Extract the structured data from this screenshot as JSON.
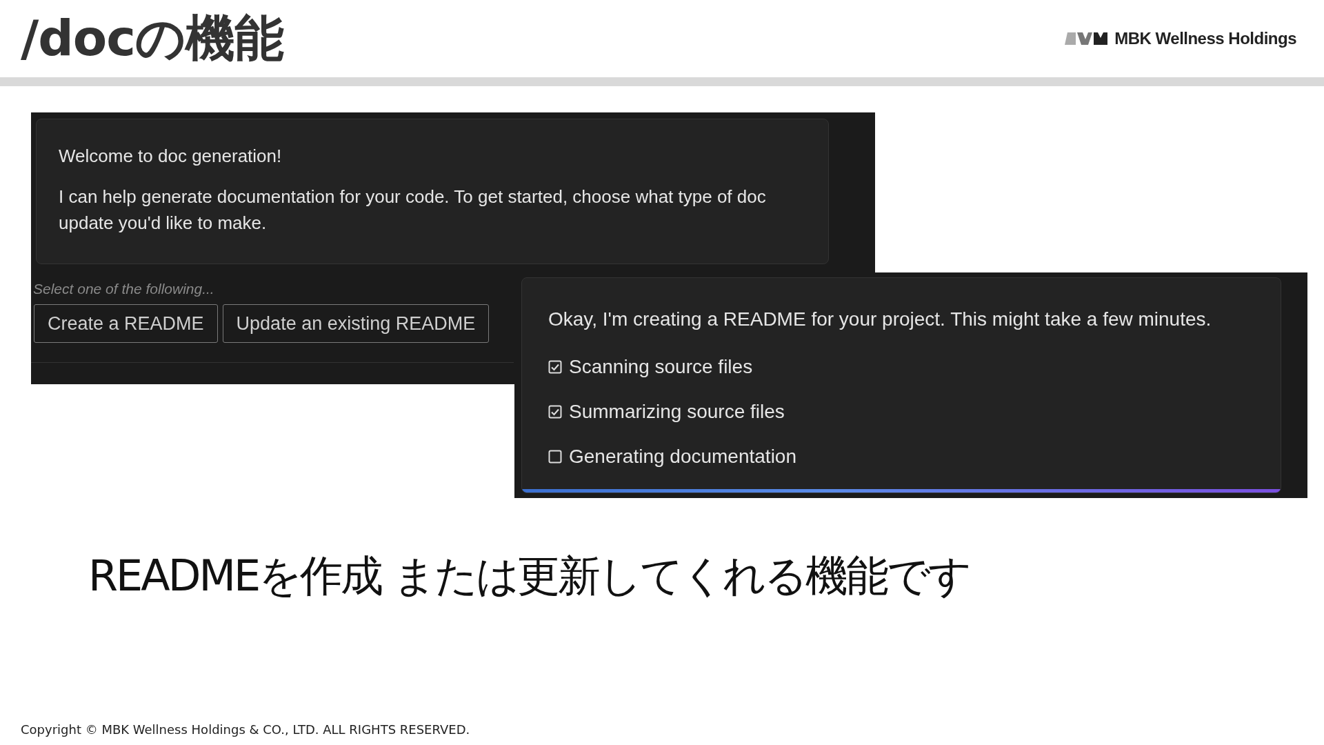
{
  "slide": {
    "title": "/docの機能",
    "brand": "MBK Wellness Holdings",
    "caption": "READMEを作成 または更新してくれる機能です",
    "copyright": "Copyright © MBK Wellness Holdings & CO., LTD. ALL RIGHTS RESERVED."
  },
  "welcome_panel": {
    "heading": "Welcome to doc generation!",
    "message": "I can help generate documentation for your code. To get started, choose what type of doc update you'd like to make.",
    "prompt": "Select one of the following...",
    "buttons": [
      "Create a README",
      "Update an existing README"
    ]
  },
  "progress_panel": {
    "level": 1,
    "message": "Okay, I'm creating a README for your project. This might take a few minutes.",
    "steps": [
      {
        "label": "Scanning source files",
        "checked": true
      },
      {
        "label": "Summarizing source files",
        "checked": true
      },
      {
        "label": "Generating documentation",
        "checked": false
      }
    ]
  }
}
